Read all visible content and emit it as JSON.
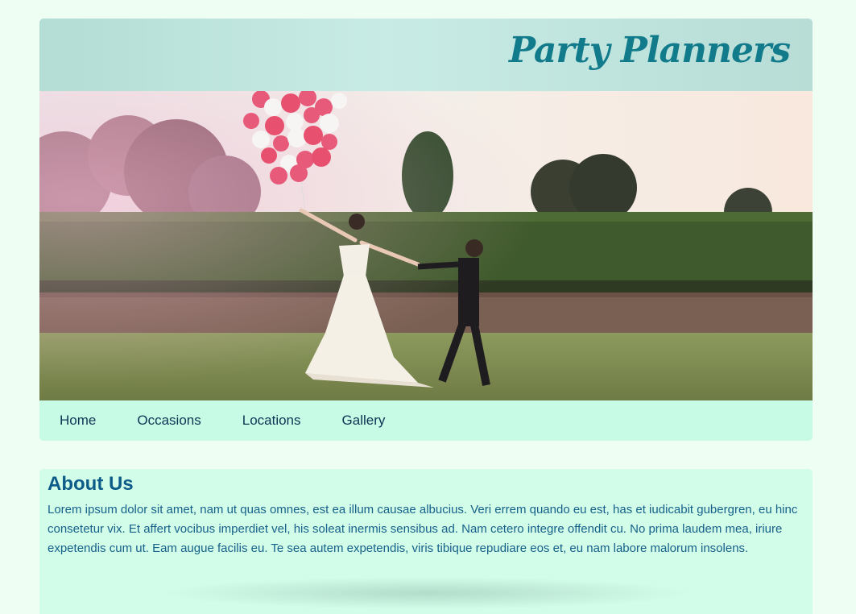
{
  "header": {
    "logo_text": "Party Planners"
  },
  "hero": {
    "image_description": "wedding-couple-with-balloons"
  },
  "nav": {
    "items": [
      {
        "label": "Home"
      },
      {
        "label": "Occasions"
      },
      {
        "label": "Locations"
      },
      {
        "label": "Gallery"
      }
    ]
  },
  "about": {
    "title": "About Us",
    "body": "Lorem ipsum dolor sit amet, nam ut quas omnes, est ea illum causae albucius. Veri errem quando eu est, has et iudicabit gubergren, eu hinc consetetur vix. Et affert vocibus imperdiet vel, his soleat inermis sensibus ad. Nam cetero integre offendit cu. No prima laudem mea, iriure expetendis cum ut. Eam augue facilis eu. Te sea autem expetendis, viris tibique repudiare eos et, eu nam labore malorum insolens."
  },
  "colors": {
    "page_bg": "#effef3",
    "header_bg": "#b3ddd5",
    "logo": "#127b8b",
    "nav_bg": "#c8fbe6",
    "nav_text": "#0d3552",
    "about_bg": "#d2fde8",
    "about_title": "#0c5b88",
    "about_text": "#16618a"
  }
}
